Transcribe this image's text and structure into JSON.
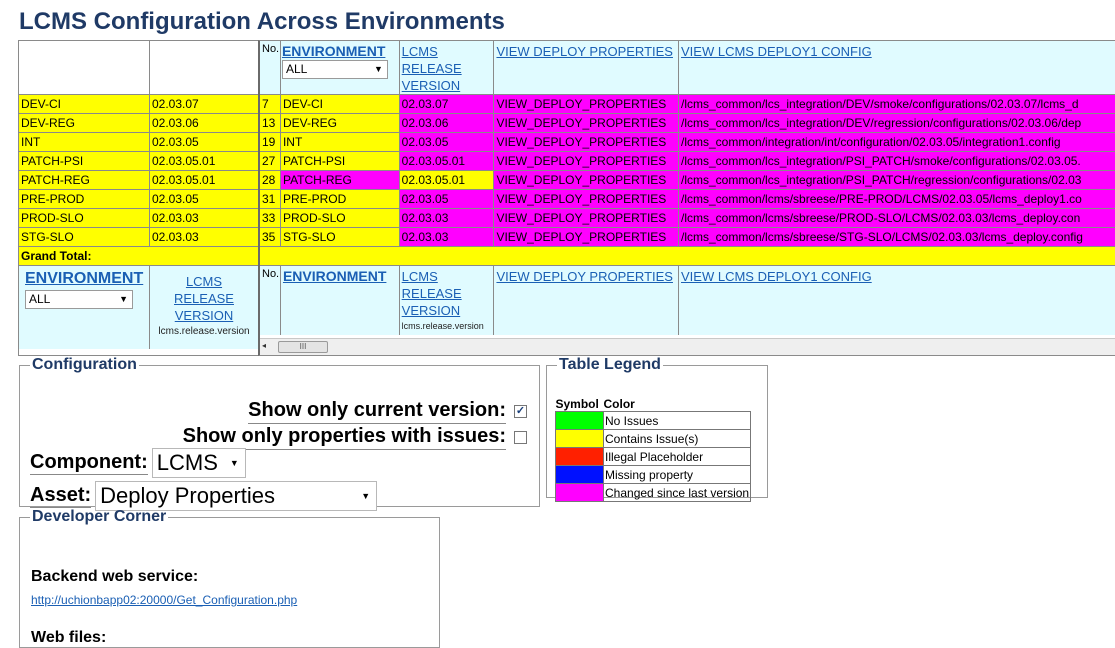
{
  "title": "LCMS Configuration Across Environments",
  "colors": {
    "yellow": "#ffff00",
    "magenta": "#ff00ff",
    "header_bg": "#e0fbff",
    "title": "#1f3a66",
    "link": "#1a5fb4"
  },
  "left": {
    "rows": [
      {
        "env": "DEV-CI",
        "version": "02.03.07"
      },
      {
        "env": "DEV-REG",
        "version": "02.03.06"
      },
      {
        "env": "INT",
        "version": "02.03.05"
      },
      {
        "env": "PATCH-PSI",
        "version": "02.03.05.01"
      },
      {
        "env": "PATCH-REG",
        "version": "02.03.05.01"
      },
      {
        "env": "PRE-PROD",
        "version": "02.03.05"
      },
      {
        "env": "PROD-SLO",
        "version": "02.03.03"
      },
      {
        "env": "STG-SLO",
        "version": "02.03.03"
      }
    ],
    "grand_total": "Grand Total:",
    "footer": {
      "env_header": "ENVIRONMENT",
      "env_filter": "ALL",
      "release_line1": "LCMS",
      "release_line2": "RELEASE",
      "release_line3": "VERSION",
      "caption": "lcms.release.version"
    }
  },
  "grid": {
    "header": {
      "no": "No.",
      "env": "ENVIRONMENT",
      "env_filter": "ALL",
      "release_line1": "LCMS",
      "release_line2": "RELEASE",
      "release_line3": "VERSION",
      "deploy_props": "VIEW DEPLOY PROPERTIES",
      "deploy_config": "VIEW LCMS DEPLOY1 CONFIG"
    },
    "rows": [
      {
        "no": "7",
        "env": "DEV-CI",
        "version": "02.03.07",
        "props": "VIEW_DEPLOY_PROPERTIES",
        "config": "/lcms_common/lcs_integration/DEV/smoke/configurations/02.03.07/lcms_d",
        "env_color": "yellow",
        "ver_color": "magenta"
      },
      {
        "no": "13",
        "env": "DEV-REG",
        "version": "02.03.06",
        "props": "VIEW_DEPLOY_PROPERTIES",
        "config": "/lcms_common/lcs_integration/DEV/regression/configurations/02.03.06/dep",
        "env_color": "yellow",
        "ver_color": "magenta"
      },
      {
        "no": "19",
        "env": "INT",
        "version": "02.03.05",
        "props": "VIEW_DEPLOY_PROPERTIES",
        "config": "/lcms_common/integration/int/configuration/02.03.05/integration1.config",
        "env_color": "yellow",
        "ver_color": "magenta"
      },
      {
        "no": "27",
        "env": "PATCH-PSI",
        "version": "02.03.05.01",
        "props": "VIEW_DEPLOY_PROPERTIES",
        "config": "/lcms_common/lcs_integration/PSI_PATCH/smoke/configurations/02.03.05.",
        "env_color": "yellow",
        "ver_color": "magenta"
      },
      {
        "no": "28",
        "env": "PATCH-REG",
        "version": "02.03.05.01",
        "props": "VIEW_DEPLOY_PROPERTIES",
        "config": "/lcms_common/lcs_integration/PSI_PATCH/regression/configurations/02.03",
        "env_color": "magenta",
        "ver_color": "yellow"
      },
      {
        "no": "31",
        "env": "PRE-PROD",
        "version": "02.03.05",
        "props": "VIEW_DEPLOY_PROPERTIES",
        "config": "/lcms_common/lcms/sbreese/PRE-PROD/LCMS/02.03.05/lcms_deploy1.co",
        "env_color": "yellow",
        "ver_color": "magenta"
      },
      {
        "no": "33",
        "env": "PROD-SLO",
        "version": "02.03.03",
        "props": "VIEW_DEPLOY_PROPERTIES",
        "config": "/lcms_common/lcms/sbreese/PROD-SLO/LCMS/02.03.03/lcms_deploy.con",
        "env_color": "yellow",
        "ver_color": "magenta"
      },
      {
        "no": "35",
        "env": "STG-SLO",
        "version": "02.03.03",
        "props": "VIEW_DEPLOY_PROPERTIES",
        "config": "/lcms_common/lcms/sbreese/STG-SLO/LCMS/02.03.03/lcms_deploy.config",
        "env_color": "yellow",
        "ver_color": "magenta"
      }
    ],
    "footer": {
      "no": "No.",
      "env": "ENVIRONMENT",
      "release_line1": "LCMS",
      "release_line2": "RELEASE",
      "release_line3": "VERSION",
      "caption": "lcms.release.version",
      "deploy_props": "VIEW DEPLOY PROPERTIES",
      "deploy_config": "VIEW LCMS DEPLOY1 CONFIG"
    },
    "scroll_thumb": "III",
    "scroll_left": "◂"
  },
  "config": {
    "legend": "Configuration",
    "show_current_label": "Show only current version:",
    "show_current_checked": true,
    "show_issues_label": "Show only properties with issues:",
    "show_issues_checked": false,
    "component_label": "Component:",
    "component_value": "LCMS",
    "asset_label": "Asset:",
    "asset_value": "Deploy Properties"
  },
  "legend_box": {
    "legend": "Table Legend",
    "symbol_header": "Symbol",
    "color_header": "Color",
    "items": [
      {
        "color": "#00ff00",
        "label": "No Issues"
      },
      {
        "color": "#ffff00",
        "label": "Contains Issue(s)"
      },
      {
        "color": "#ff2000",
        "label": "Illegal Placeholder"
      },
      {
        "color": "#0010ff",
        "label": "Missing property"
      },
      {
        "color": "#ff00ff",
        "label": "Changed since last version"
      }
    ]
  },
  "dev": {
    "legend": "Developer Corner",
    "backend_label": "Backend web service:",
    "backend_url": "http://uchionbapp02:20000/Get_Configuration.php",
    "web_files_label": "Web files:"
  }
}
